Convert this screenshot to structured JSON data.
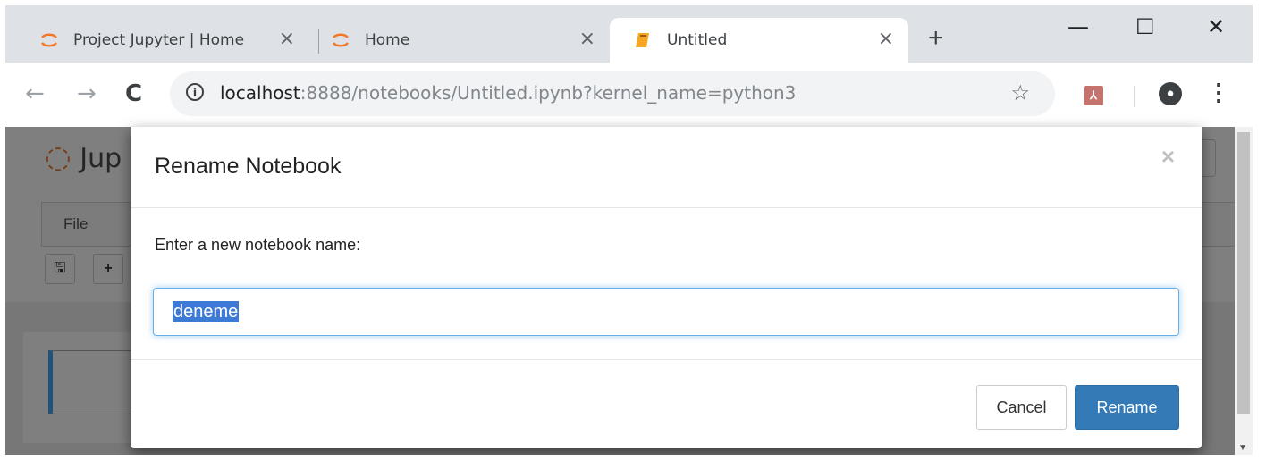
{
  "browser": {
    "tabs": [
      {
        "title": "Project Jupyter | Home",
        "icon": "jupyter-logo-icon",
        "close": "×"
      },
      {
        "title": "Home",
        "icon": "jupyter-logo-icon",
        "close": "×"
      },
      {
        "title": "Untitled",
        "icon": "notebook-icon",
        "close": "×",
        "active": true
      }
    ],
    "new_tab": "+",
    "window_controls": {
      "minimize": "—",
      "maximize": "☐",
      "close": "✕"
    },
    "address": {
      "host": "localhost",
      "rest": ":8888/notebooks/Untitled.ipynb?kernel_name=python3"
    },
    "nav": {
      "back": "←",
      "forward": "→",
      "reload": "C"
    }
  },
  "jupyter": {
    "logo_text": "Jup",
    "menu_file": "File",
    "toolbar_save": "🖫",
    "toolbar_add": "+",
    "cell_prompt": ":"
  },
  "modal": {
    "title": "Rename Notebook",
    "close": "×",
    "label": "Enter a new notebook name:",
    "input_value": "deneme",
    "cancel": "Cancel",
    "rename": "Rename"
  },
  "colors": {
    "accent": "#337ab7",
    "jupyter_orange": "#f37726",
    "selection": "#3d7ad6"
  }
}
